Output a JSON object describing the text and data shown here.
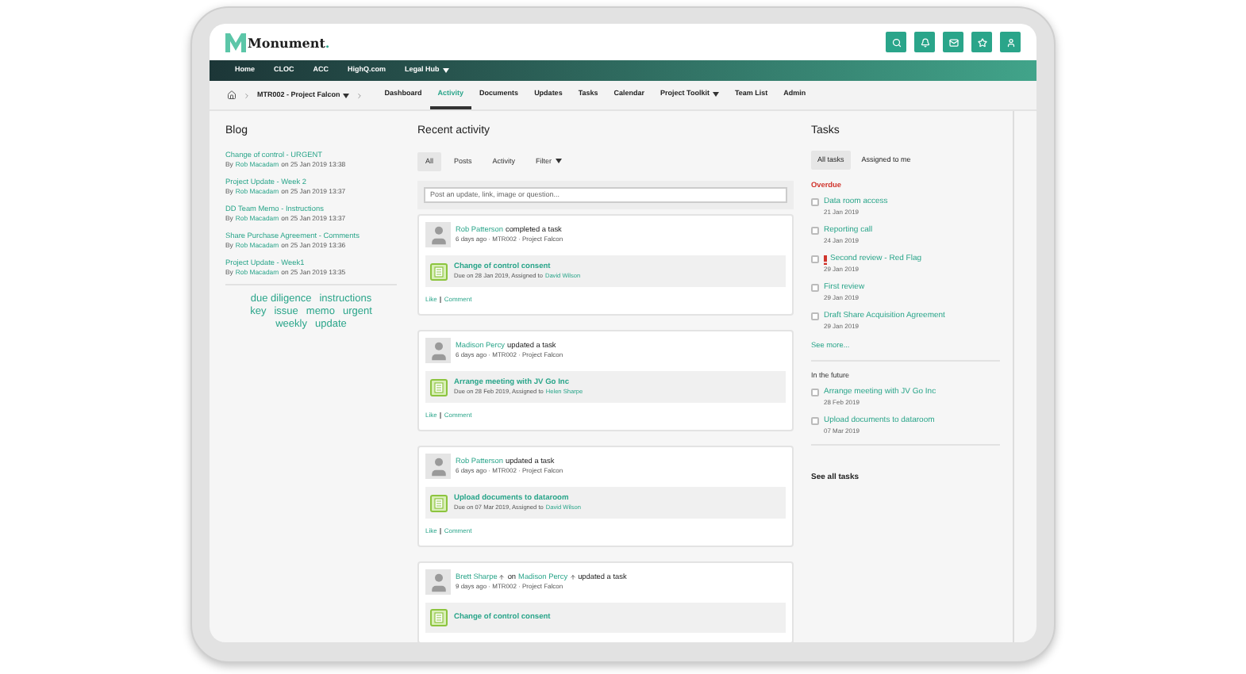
{
  "header": {
    "logo_name": "Monument",
    "logo_dot": "."
  },
  "nav": [
    {
      "label": "Home",
      "dropdown": false
    },
    {
      "label": "CLOC",
      "dropdown": false
    },
    {
      "label": "ACC",
      "dropdown": false
    },
    {
      "label": "HighQ.com",
      "dropdown": false
    },
    {
      "label": "Legal Hub",
      "dropdown": true
    }
  ],
  "subnav": {
    "project": "MTR002 - Project Falcon",
    "tabs": [
      {
        "label": "Dashboard",
        "selected": false,
        "dropdown": false
      },
      {
        "label": "Activity",
        "selected": true,
        "dropdown": false
      },
      {
        "label": "Documents",
        "selected": false,
        "dropdown": false
      },
      {
        "label": "Updates",
        "selected": false,
        "dropdown": false
      },
      {
        "label": "Tasks",
        "selected": false,
        "dropdown": false
      },
      {
        "label": "Calendar",
        "selected": false,
        "dropdown": false
      },
      {
        "label": "Project Toolkit",
        "selected": false,
        "dropdown": true
      },
      {
        "label": "Team List",
        "selected": false,
        "dropdown": false
      },
      {
        "label": "Admin",
        "selected": false,
        "dropdown": false
      }
    ]
  },
  "blog": {
    "title": "Blog",
    "posts": [
      {
        "title": "Change of control - URGENT",
        "by": "By",
        "author": "Rob Macadam",
        "date": "on 25 Jan 2019 13:38"
      },
      {
        "title": "Project Update - Week 2",
        "by": "By",
        "author": "Rob Macadam",
        "date": "on 25 Jan 2019 13:37"
      },
      {
        "title": "DD Team Memo - Instructions",
        "by": "By",
        "author": "Rob Macadam",
        "date": "on 25 Jan 2019 13:37"
      },
      {
        "title": "Share Purchase Agreement - Comments",
        "by": "By",
        "author": "Rob Macadam",
        "date": "on 25 Jan 2019 13:36"
      },
      {
        "title": "Project Update - Week1",
        "by": "By",
        "author": "Rob Macadam",
        "date": "on 25 Jan 2019 13:35"
      }
    ],
    "tags": [
      "due diligence",
      "instructions",
      "key",
      "issue",
      "memo",
      "urgent",
      "weekly",
      "update"
    ]
  },
  "activity": {
    "title": "Recent activity",
    "filters": [
      {
        "label": "All",
        "selected": true,
        "dropdown": false
      },
      {
        "label": "Posts",
        "selected": false,
        "dropdown": false
      },
      {
        "label": "Activity",
        "selected": false,
        "dropdown": false
      },
      {
        "label": "Filter",
        "selected": false,
        "dropdown": true
      }
    ],
    "composer": {
      "placeholder": "Post an update, link, image or question..."
    },
    "items": [
      {
        "actors": [
          {
            "name": "Rob Patterson",
            "arrow": false
          }
        ],
        "action": "completed a task",
        "meta": "6 days ago · MTR002 · Project Falcon",
        "task": {
          "title": "Change of control consent",
          "due": "Due on 28 Jan 2019, Assigned to",
          "assignee": "David Wilson"
        },
        "links": [
          "Like",
          "Comment"
        ]
      },
      {
        "actors": [
          {
            "name": "Madison Percy",
            "arrow": false
          }
        ],
        "action": "updated a task",
        "meta": "6 days ago · MTR002 · Project Falcon",
        "task": {
          "title": "Arrange meeting with JV Go Inc",
          "due": "Due on 28 Feb 2019, Assigned to",
          "assignee": "Helen Sharpe"
        },
        "links": [
          "Like",
          "Comment"
        ]
      },
      {
        "actors": [
          {
            "name": "Rob Patterson",
            "arrow": false
          }
        ],
        "action": "updated a task",
        "meta": "6 days ago · MTR002 · Project Falcon",
        "task": {
          "title": "Upload documents to dataroom",
          "due": "Due on 07 Mar 2019, Assigned to",
          "assignee": "David Wilson"
        },
        "links": [
          "Like",
          "Comment"
        ]
      },
      {
        "actors": [
          {
            "name": "Brett Sharpe",
            "arrow": true
          },
          {
            "name": "Madison Percy",
            "arrow": true
          }
        ],
        "joiner": "on",
        "action": "updated a task",
        "meta": "9 days ago · MTR002 · Project Falcon",
        "task": {
          "title": "Change of control consent"
        }
      }
    ]
  },
  "tasks": {
    "title": "Tasks",
    "tabs": [
      {
        "label": "All tasks",
        "selected": true
      },
      {
        "label": "Assigned to me",
        "selected": false
      }
    ],
    "overdue_label": "Overdue",
    "overdue": [
      {
        "title": "Data room access",
        "date": "21 Jan 2019",
        "checked": false,
        "flagged": false
      },
      {
        "title": "Reporting call",
        "date": "24 Jan 2019",
        "checked": false,
        "flagged": false
      },
      {
        "title": "Second review - Red Flag",
        "date": "29 Jan 2019",
        "checked": false,
        "flagged": true
      },
      {
        "title": "First review",
        "date": "29 Jan 2019",
        "checked": false,
        "flagged": false
      },
      {
        "title": "Draft Share Acquisition Agreement",
        "date": "29 Jan 2019",
        "checked": false,
        "flagged": false
      }
    ],
    "see_more": "See more...",
    "future_label": "In the future",
    "future": [
      {
        "title": "Arrange meeting with JV Go Inc",
        "date": "28 Feb 2019",
        "checked": false,
        "flagged": false
      },
      {
        "title": "Upload documents to dataroom",
        "date": "07 Mar 2019",
        "checked": false,
        "flagged": false
      }
    ],
    "see_all": "See all tasks"
  }
}
